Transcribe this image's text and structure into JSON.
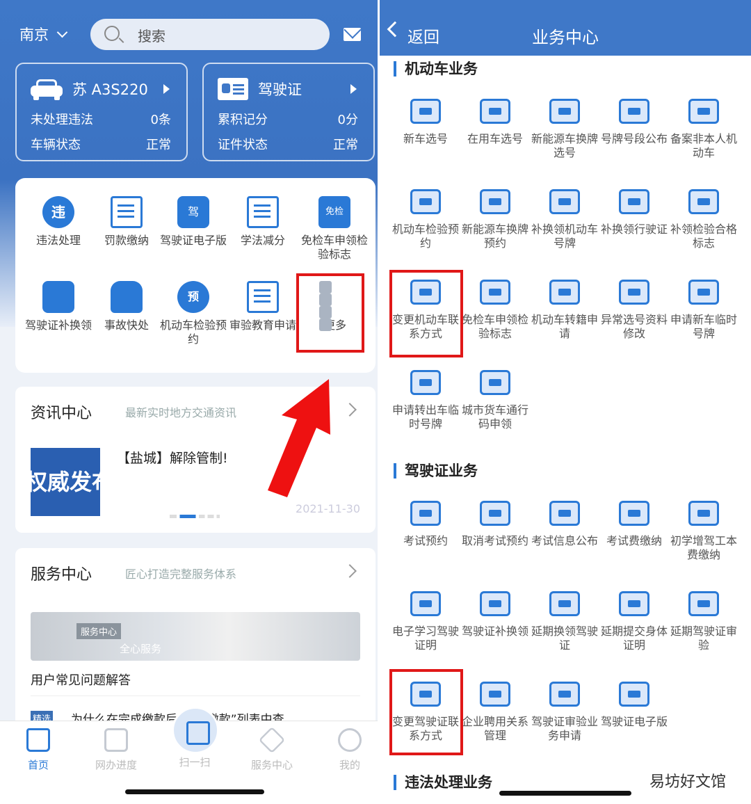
{
  "left": {
    "city": "南京",
    "search_placeholder": "搜索",
    "vehicle_card": {
      "title": "苏 A3S220",
      "rows": [
        {
          "label": "未处理违法",
          "value": "0条"
        },
        {
          "label": "车辆状态",
          "value": "正常"
        }
      ]
    },
    "license_card": {
      "title": "驾驶证",
      "rows": [
        {
          "label": "累积记分",
          "value": "0分"
        },
        {
          "label": "证件状态",
          "value": "正常"
        }
      ]
    },
    "grid": [
      {
        "label": "违法处理",
        "icon": "violation-icon",
        "glyph": "违"
      },
      {
        "label": "罚款缴纳",
        "icon": "fine-icon",
        "glyph": ""
      },
      {
        "label": "驾驶证电子版",
        "icon": "e-license-icon",
        "glyph": "驾"
      },
      {
        "label": "学法减分",
        "icon": "book-icon",
        "glyph": ""
      },
      {
        "label": "免检车申领检验标志",
        "icon": "exempt-icon",
        "glyph": "免检"
      },
      {
        "label": "驾驶证补换领",
        "icon": "license-renew-icon",
        "glyph": ""
      },
      {
        "label": "事故快处",
        "icon": "accident-icon",
        "glyph": ""
      },
      {
        "label": "机动车检验预约",
        "icon": "inspection-icon",
        "glyph": "预"
      },
      {
        "label": "审验教育申请",
        "icon": "document-icon",
        "glyph": ""
      },
      {
        "label": "更多",
        "icon": "more-icon",
        "glyph": ""
      }
    ],
    "news": {
      "title": "资讯中心",
      "subtitle": "最新实时地方交通资讯",
      "image_text": "权威发布",
      "headline": "【盐城】解除管制!",
      "date": "2021-11-30"
    },
    "service": {
      "title": "服务中心",
      "subtitle": "匠心打造完整服务体系",
      "image_tag": "服务中心",
      "image_caption": "全心服务",
      "faq": "用户常见问题解答",
      "faq_item": "为什么在完成缴款后在“已缴款”列表中查",
      "faq_tag": "精选"
    },
    "tabs": [
      {
        "label": "首页",
        "icon": "home-icon"
      },
      {
        "label": "网办进度",
        "icon": "progress-icon"
      },
      {
        "label": "扫一扫",
        "icon": "scan-icon"
      },
      {
        "label": "服务中心",
        "icon": "service-icon"
      },
      {
        "label": "我的",
        "icon": "profile-icon"
      }
    ]
  },
  "right": {
    "back_label": "返回",
    "title": "业务中心",
    "sections": [
      {
        "title": "机动车业务",
        "items": [
          "新车选号",
          "在用车选号",
          "新能源车换牌选号",
          "号牌号段公布",
          "备案非本人机动车",
          "机动车检验预约",
          "新能源车换牌预约",
          "补换领机动车号牌",
          "补换领行驶证",
          "补领检验合格标志",
          "变更机动车联系方式",
          "免检车申领检验标志",
          "机动车转籍申请",
          "异常选号资料修改",
          "申请新车临时号牌",
          "申请转出车临时号牌",
          "城市货车通行码申领"
        ]
      },
      {
        "title": "驾驶证业务",
        "items": [
          "考试预约",
          "取消考试预约",
          "考试信息公布",
          "考试费缴纳",
          "初学增驾工本费缴纳",
          "电子学习驾驶证明",
          "驾驶证补换领",
          "延期换领驾驶证",
          "延期提交身体证明",
          "延期驾驶证审验",
          "变更驾驶证联系方式",
          "企业聘用关系管理",
          "驾驶证审验业务申请",
          "驾驶证电子版"
        ]
      },
      {
        "title": "违法处理业务",
        "items": []
      }
    ]
  },
  "watermark": "易坊好文馆",
  "accent": "#2a79d6",
  "highlight": "#e01818"
}
